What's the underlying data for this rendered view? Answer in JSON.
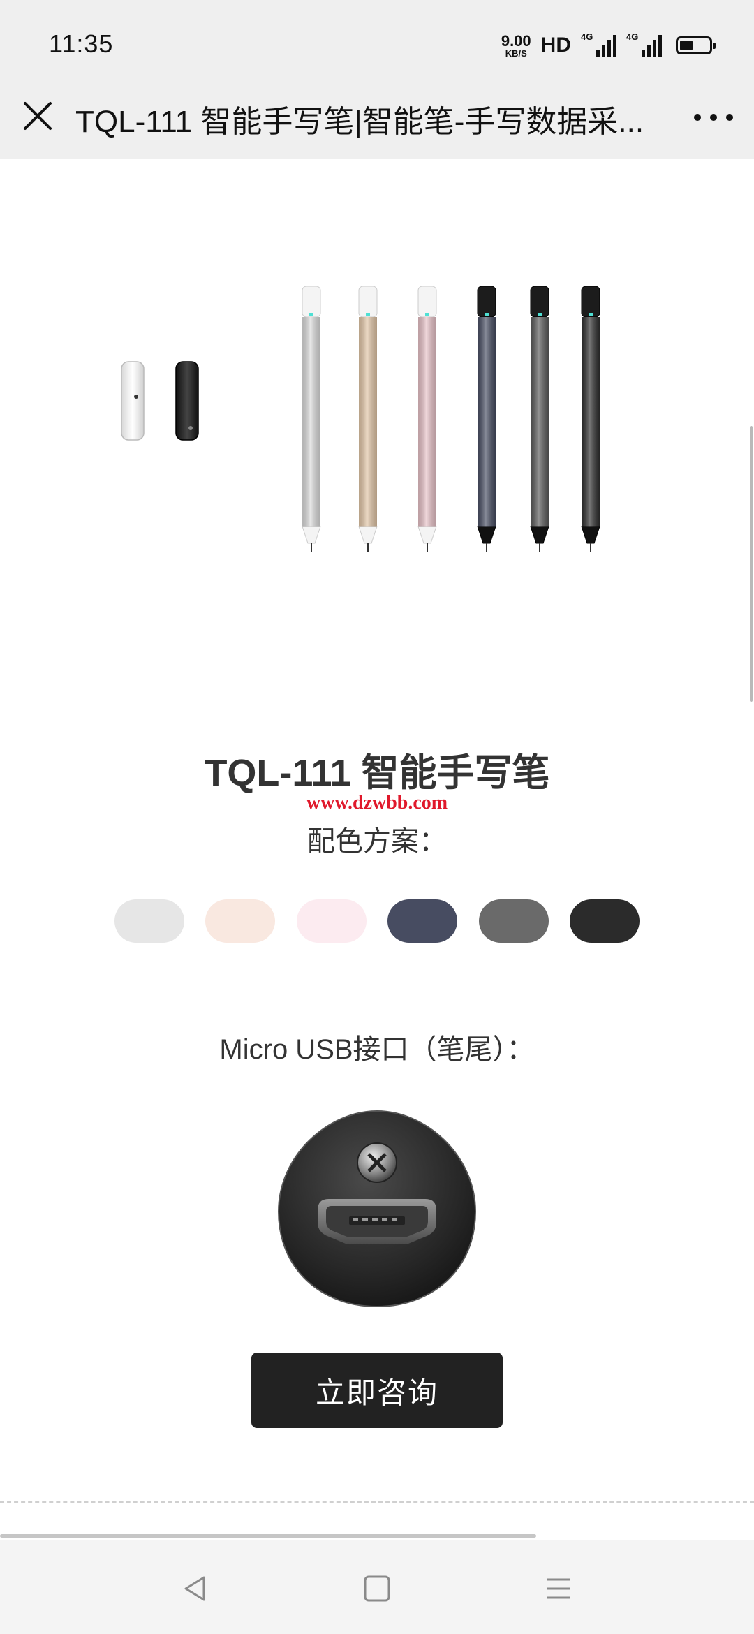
{
  "status_bar": {
    "time": "11:35",
    "net_speed_value": "9.00",
    "net_speed_unit": "KB/S",
    "hd_label": "HD",
    "signal1_label": "4G",
    "signal2_label": "4G",
    "battery_level": 0.45
  },
  "title_bar": {
    "title": "TQL-111 智能手写笔|智能笔-手写数据采...",
    "close_icon": "close-icon",
    "more_icon": "more-dots-icon"
  },
  "hero": {
    "pen_colors": [
      "#dcdcdc",
      "#e3c7a8",
      "#e8c2c8",
      "#474d62",
      "#5a5a5a",
      "#2e2e2e"
    ],
    "cap_colors": [
      "#f2f2f2",
      "#2a2a2a"
    ]
  },
  "product": {
    "title": "TQL-111 智能手写笔",
    "watermark": "www.dzwbb.com",
    "color_label": "配色方案：",
    "swatches": [
      "#e6e6e6",
      "#f9e8e0",
      "#fcebf0",
      "#474c61",
      "#6a6a6a",
      "#2b2b2b"
    ],
    "usb_label": "Micro USB接口（笔尾）：",
    "cta_label": "立即咨询"
  },
  "nav_bar": {
    "back_icon": "back-triangle-icon",
    "home_icon": "home-square-icon",
    "menu_icon": "menu-lines-icon"
  }
}
